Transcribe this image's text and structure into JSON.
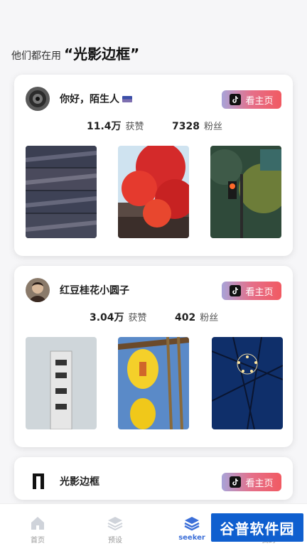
{
  "header": {
    "prefix": "他们都在用",
    "brand": "“光影边框”"
  },
  "cards": [
    {
      "name": "你好，陌生人",
      "button": "看主页",
      "likes_value": "11.4万",
      "likes_label": "获赞",
      "fans_value": "7328",
      "fans_label": "粉丝"
    },
    {
      "name": "红豆桂花小圆子",
      "button": "看主页",
      "likes_value": "3.04万",
      "likes_label": "获赞",
      "fans_value": "402",
      "fans_label": "粉丝"
    },
    {
      "name": "光影边框",
      "button": "看主页"
    }
  ],
  "tabs": [
    {
      "label": "首页",
      "icon": "home-icon"
    },
    {
      "label": "预设",
      "icon": "layers-icon"
    },
    {
      "label": "seeker",
      "icon": "stack-icon"
    },
    {
      "label": "我的",
      "icon": "user-icon"
    }
  ],
  "watermark": "谷普软件园",
  "colors": {
    "accent": "#3c6fd8",
    "button_start": "#a8a3d8",
    "button_end": "#f15a62"
  }
}
